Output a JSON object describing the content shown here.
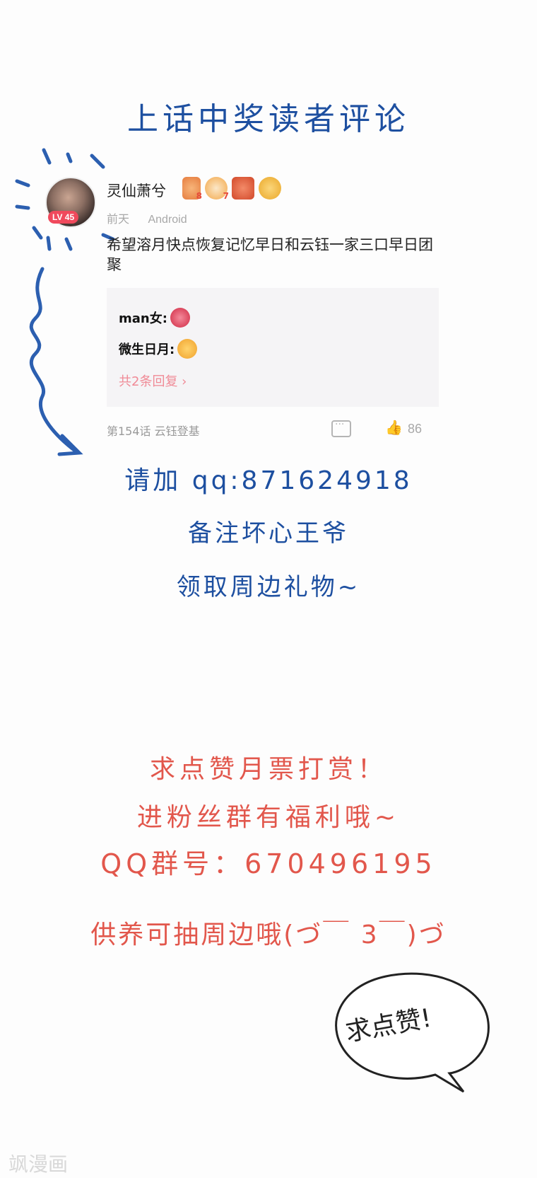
{
  "title": "上话中奖读者评论",
  "comment": {
    "avatar_icon": "avatar",
    "level": "LV 45",
    "username": "灵仙萧兮",
    "badges": [
      {
        "icon": "badge-flower-icon",
        "count": "8"
      },
      {
        "icon": "badge-face-icon",
        "count": "7"
      },
      {
        "icon": "badge-gift-icon",
        "count": ""
      },
      {
        "icon": "badge-crown-icon",
        "count": ""
      }
    ],
    "time": "前天",
    "device": "Android",
    "text": "希望溶月快点恢复记忆早日和云钰一家三口早日团聚",
    "replies": [
      {
        "user": "man女:",
        "emoji": "gem-icon"
      },
      {
        "user": "微生日月:",
        "emoji": "thumbs-up-icon"
      }
    ],
    "reply_count": "共2条回复 ›",
    "chapter": "第154话 云钰登基",
    "like_count": "86"
  },
  "promo_blue": {
    "qq": "请加 qq:871624918",
    "note": "备注坏心王爷",
    "gift": "领取周边礼物~"
  },
  "promo_red": {
    "like": "求点赞月票打赏！",
    "fans": "进粉丝群有福利哦~",
    "group": "QQ群号：670496195",
    "support": "供养可抽周边哦(づ￣ 3￣)づ"
  },
  "bubble": "求点赞!",
  "watermark": "飒漫画",
  "colors": {
    "blue": "#1d4fa0",
    "red": "#e2574c",
    "lv": "#f0495c"
  }
}
